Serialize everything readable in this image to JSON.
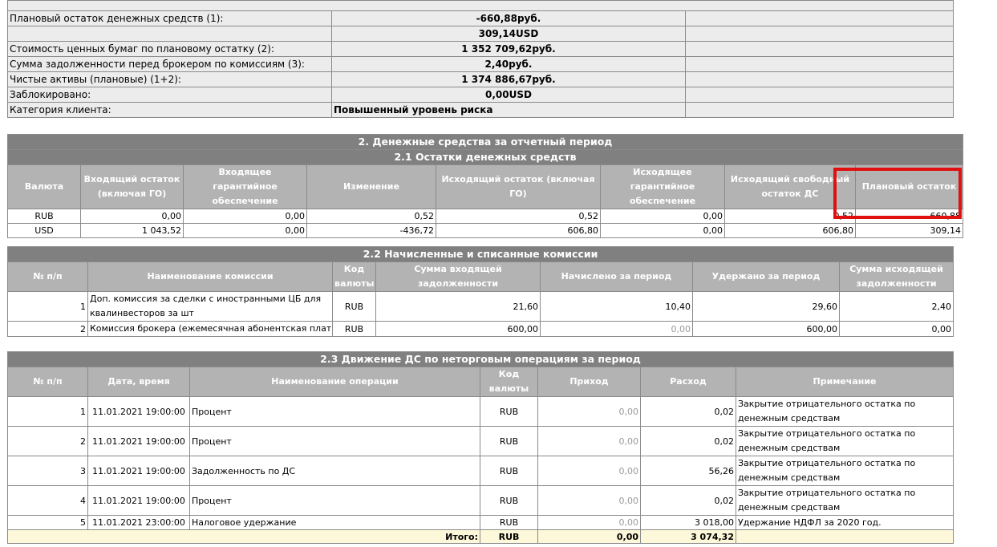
{
  "summary": [
    {
      "label": "Плановый остаток денежных средств (1):",
      "value": "-660,88руб."
    },
    {
      "label": "",
      "value": "309,14USD"
    },
    {
      "label": "Стоимость ценных бумаг по плановому остатку (2):",
      "value": "1 352 709,62руб."
    },
    {
      "label": "Сумма задолженности перед брокером по комиссиям (3):",
      "value": "2,40руб."
    },
    {
      "label": "Чистые активы (плановые) (1+2):",
      "value": "1 374 886,67руб."
    },
    {
      "label": "Заблокировано:",
      "value": "0,00USD"
    },
    {
      "label": "Категория клиента:",
      "value": "Повышенный уровень риска"
    }
  ],
  "section2": {
    "title": "2. Денежные средства за отчетный период",
    "sub1": {
      "title": "2.1 Остатки денежных средств",
      "headers": [
        "Валюта",
        "Входящий остаток (включая ГО)",
        "Входящее гарантийное обеспечение",
        "Изменение",
        "Исходящий остаток (включая ГО)",
        "Исходящее гарантийное обеспечение",
        "Исходящий свободный остаток ДС",
        "Плановый остаток"
      ],
      "rows": [
        [
          "RUB",
          "0,00",
          "0,00",
          "0,52",
          "0,52",
          "0,00",
          "0,52",
          "-660,88"
        ],
        [
          "USD",
          "1 043,52",
          "0,00",
          "-436,72",
          "606,80",
          "0,00",
          "606,80",
          "309,14"
        ]
      ]
    },
    "sub2": {
      "title": "2.2 Начисленные и списанные комиссии",
      "headers": [
        "№ п/п",
        "Наименование комиссии",
        "Код валюты",
        "Сумма входящей задолженности",
        "Начислено за период",
        "Удержано за период",
        "Сумма исходящей задолженности"
      ],
      "rows": [
        {
          "n": "1",
          "name": "Доп. комиссия за сделки с иностранными ЦБ для квалинвесторов за шт",
          "cur": "RUB",
          "in": "21,60",
          "accr": "10,40",
          "held": "29,60",
          "out": "2,40"
        },
        {
          "n": "2",
          "name": "Комиссия брокера (ежемесячная абонентская плата)",
          "cur": "RUB",
          "in": "600,00",
          "accr": "0,00",
          "held": "600,00",
          "out": "0,00"
        }
      ]
    },
    "sub3": {
      "title": "2.3 Движение ДС по неторговым операциям за период",
      "headers": [
        "№ п/п",
        "Дата, время",
        "Наименование операции",
        "Код валюты",
        "Приход",
        "Расход",
        "Примечание"
      ],
      "rows": [
        {
          "n": "1",
          "dt": "11.01.2021 19:00:00",
          "op": "Процент",
          "cur": "RUB",
          "in": "0,00",
          "out": "0,02",
          "note": "Закрытие отрицательного остатка по денежным средствам"
        },
        {
          "n": "2",
          "dt": "11.01.2021 19:00:00",
          "op": "Процент",
          "cur": "RUB",
          "in": "0,00",
          "out": "0,02",
          "note": "Закрытие отрицательного остатка по денежным средствам"
        },
        {
          "n": "3",
          "dt": "11.01.2021 19:00:00",
          "op": "Задолженность по ДС",
          "cur": "RUB",
          "in": "0,00",
          "out": "56,26",
          "note": "Закрытие отрицательного остатка по денежным средствам"
        },
        {
          "n": "4",
          "dt": "11.01.2021 19:00:00",
          "op": "Процент",
          "cur": "RUB",
          "in": "0,00",
          "out": "0,02",
          "note": "Закрытие отрицательного остатка по денежным средствам"
        },
        {
          "n": "5",
          "dt": "11.01.2021 23:00:00",
          "op": "Налоговое удержание",
          "cur": "RUB",
          "in": "0,00",
          "out": "3 018,00",
          "note": "Удержание НДФЛ за 2020 год."
        }
      ],
      "total": {
        "label": "Итого:",
        "cur": "RUB",
        "in": "0,00",
        "out": "3 074,32"
      }
    }
  },
  "colors": {
    "highlight": "#e01010",
    "header_dark": "#808080",
    "header_light": "#b3b3b3",
    "total_bg": "#fdf8d9"
  }
}
